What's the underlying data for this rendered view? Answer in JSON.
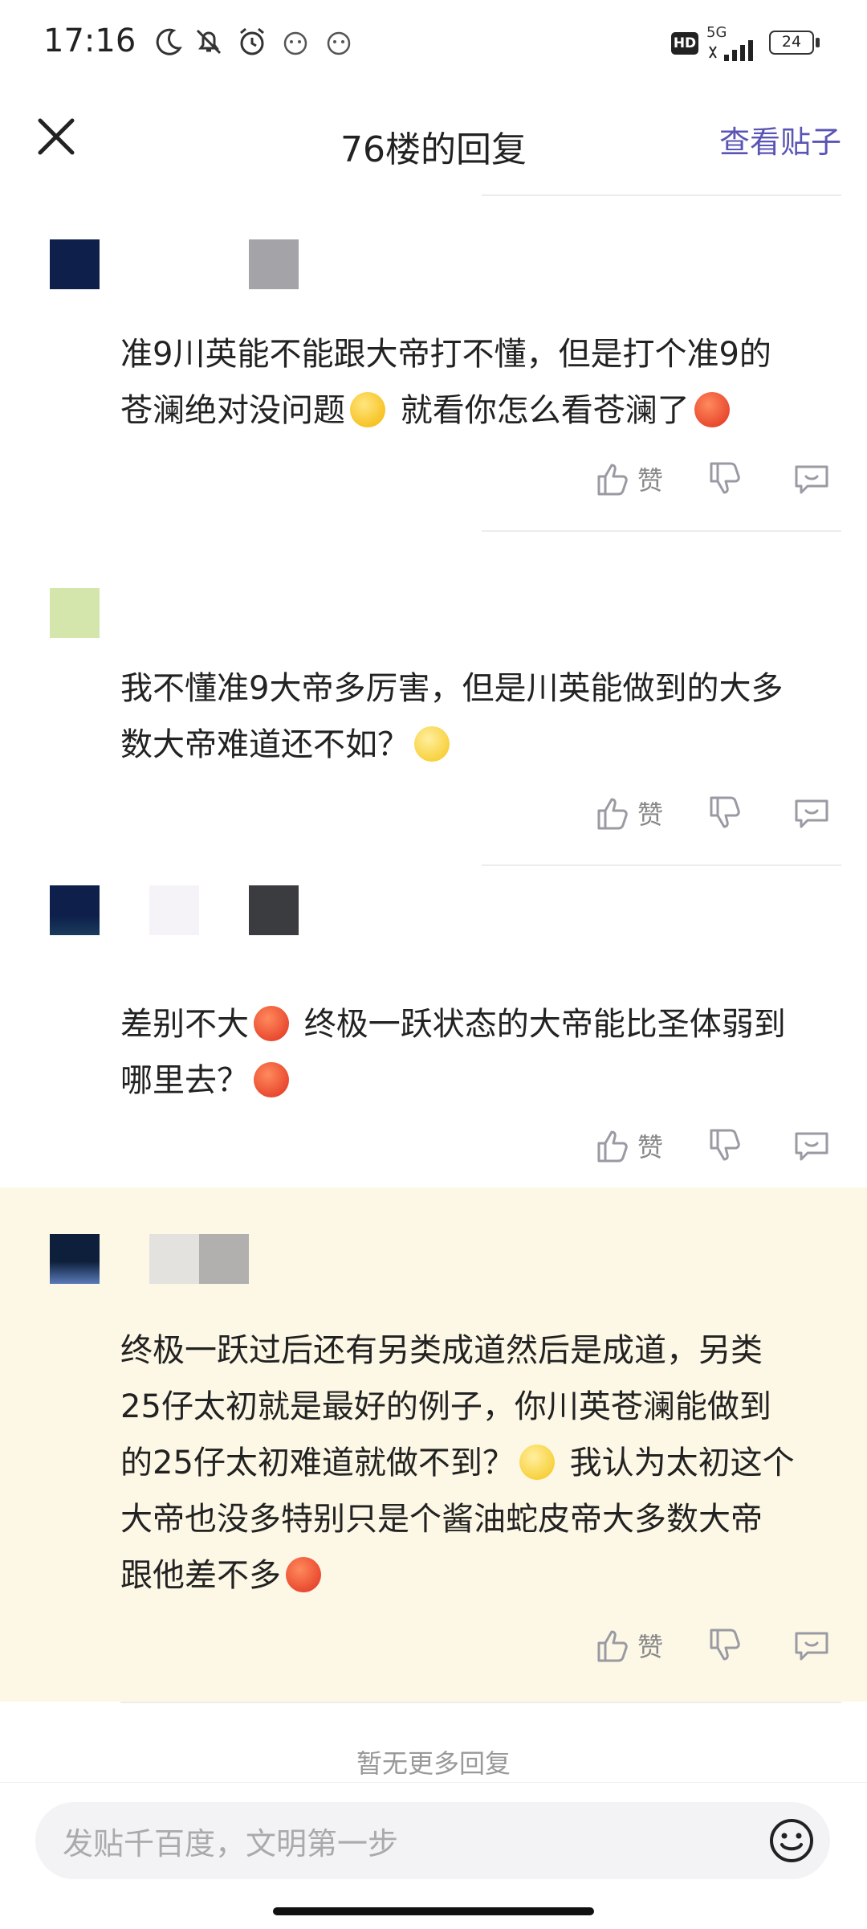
{
  "status_bar": {
    "time": "17:16",
    "network": "5G",
    "hd": "HD",
    "battery": "24",
    "icons": [
      "moon-icon",
      "notification-off-icon",
      "alarm-icon",
      "app-icon",
      "app-icon"
    ]
  },
  "header": {
    "title": "76楼的回复",
    "view_post": "查看贴子",
    "close_icon": "close-icon"
  },
  "replies": [
    {
      "content_parts": [
        "准9川英能不能跟大帝打不懂，但是打个准9的",
        "苍澜绝对没问题",
        "就看你怎么看苍澜了"
      ],
      "like_label": "赞"
    },
    {
      "content_parts": [
        "我不懂准9大帝多厉害，但是川英能做到的大多",
        "数大帝难道还不如？"
      ],
      "like_label": "赞"
    },
    {
      "content_parts": [
        "差别不大",
        "终极一跃状态的大帝能比圣体弱到",
        "哪里去？"
      ],
      "like_label": "赞"
    },
    {
      "content_parts": [
        "终极一跃过后还有另类成道然后是成道，另类",
        "25仔太初就是最好的例子，你川英苍澜能做到",
        "的25仔太初难道就做不到？",
        "我认为太初这个",
        "大帝也没多特别只是个酱油蛇皮帝大多数大帝",
        "跟他差不多"
      ],
      "like_label": "赞"
    }
  ],
  "footer": {
    "no_more": "暂无更多回复",
    "input_placeholder": "发贴千百度，文明第一步"
  },
  "colors": {
    "accent": "#5a55b4",
    "highlight_bg": "#fdf8e6"
  }
}
